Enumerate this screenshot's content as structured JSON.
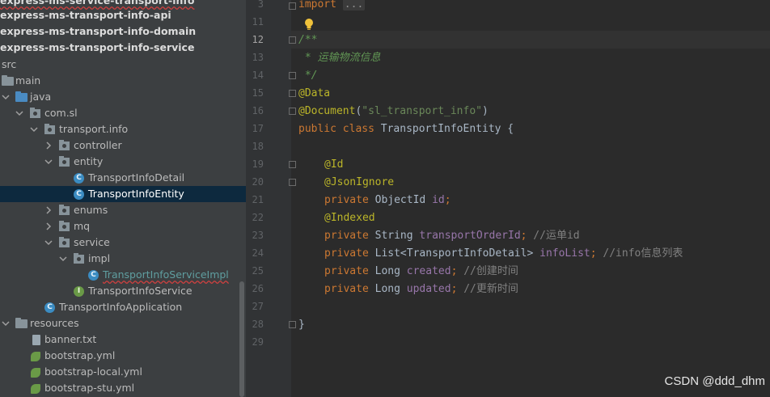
{
  "project_tree": {
    "header": "express-ms-service-transport-info",
    "modules": [
      "express-ms-transport-info-api",
      "express-ms-transport-info-domain",
      "express-ms-transport-info-service"
    ],
    "items": [
      {
        "label": "src"
      },
      {
        "label": "main"
      },
      {
        "label": "java"
      },
      {
        "label": "com.sl"
      },
      {
        "label": "transport.info"
      },
      {
        "label": "controller"
      },
      {
        "label": "entity"
      },
      {
        "label": "TransportInfoDetail"
      },
      {
        "label": "TransportInfoEntity"
      },
      {
        "label": "enums"
      },
      {
        "label": "mq"
      },
      {
        "label": "service"
      },
      {
        "label": "impl"
      },
      {
        "label": "TransportInfoServiceImpl"
      },
      {
        "label": "TransportInfoService"
      },
      {
        "label": "TransportInfoApplication"
      },
      {
        "label": "resources"
      },
      {
        "label": "banner.txt"
      },
      {
        "label": "bootstrap.yml"
      },
      {
        "label": "bootstrap-local.yml"
      },
      {
        "label": "bootstrap-stu.yml"
      }
    ],
    "selected": "TransportInfoEntity"
  },
  "editor": {
    "line_numbers": [
      "3",
      "11",
      "12",
      "13",
      "14",
      "15",
      "16",
      "17",
      "18",
      "19",
      "20",
      "21",
      "22",
      "23",
      "24",
      "25",
      "26",
      "27",
      "28",
      "29"
    ],
    "current_line": "12",
    "code": {
      "import_kw": "import",
      "import_fold": "...",
      "doc_open": "/**",
      "doc_text": " * 运输物流信息",
      "doc_close": " */",
      "ann_data": "@Data",
      "ann_document": "@Document",
      "doc_paren_open": "(",
      "doc_name": "\"sl_transport_info\"",
      "doc_paren_close": ")",
      "class_public": "public",
      "class_kw": "class",
      "class_name": " TransportInfoEntity {",
      "ann_id": "@Id",
      "ann_jsonignore": "@JsonIgnore",
      "ann_indexed": "@Indexed",
      "private_kw": "private",
      "f1_type": " ObjectId ",
      "f1_name": "id",
      "f2_type": " String ",
      "f2_name": "transportOrderId",
      "f2_comment": " //运单id",
      "f3_type": " List<TransportInfoDetail> ",
      "f3_name": "infoList",
      "f3_comment": " //info信息列表",
      "f4_type": " Long ",
      "f4_name": "created",
      "f4_comment": " //创建时间",
      "f5_type": " Long ",
      "f5_name": "updated",
      "f5_comment": " //更新时间",
      "semicolon": ";",
      "close_brace": "}"
    }
  },
  "watermark": "CSDN @ddd_dhm",
  "icons": {
    "bulb": "lightbulb-icon",
    "class": "class-icon",
    "interface": "interface-icon",
    "folder": "folder-icon",
    "package": "package-icon",
    "yaml": "yaml-file-icon",
    "text": "text-file-icon"
  },
  "colors": {
    "tree_bg": "#3c3f41",
    "editor_bg": "#2b2b2b",
    "selection": "#0d293e",
    "keyword": "#cc7832",
    "annotation": "#bbb529",
    "string": "#6a8759",
    "field": "#9876aa",
    "comment": "#808080",
    "doc_comment": "#629755"
  }
}
